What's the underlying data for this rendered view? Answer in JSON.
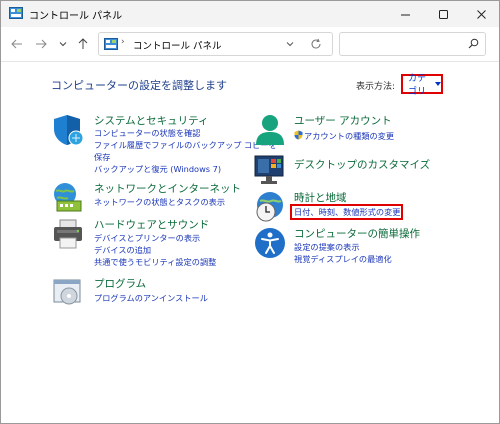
{
  "window": {
    "title": "コントロール パネル"
  },
  "nav": {
    "breadcrumb_separator": "›",
    "address_path": "コントロール パネル",
    "search_placeholder": ""
  },
  "main": {
    "heading": "コンピューターの設定を調整します",
    "view_by_label": "表示方法:",
    "view_by_value": "カテゴリ"
  },
  "categories": [
    {
      "title": "システムとセキュリティ",
      "links": [
        "コンピューターの状態を確認",
        "ファイル履歴でファイルのバックアップ コピーを",
        "保存",
        "バックアップと復元 (Windows 7)"
      ]
    },
    {
      "title": "ネットワークとインターネット",
      "links": [
        "ネットワークの状態とタスクの表示"
      ]
    },
    {
      "title": "ハードウェアとサウンド",
      "links": [
        "デバイスとプリンターの表示",
        "デバイスの追加",
        "共通で使うモビリティ設定の調整"
      ]
    },
    {
      "title": "プログラム",
      "links": [
        "プログラムのアンインストール"
      ]
    },
    {
      "title": "ユーザー アカウント",
      "links": [
        "アカウントの種類の変更"
      ]
    },
    {
      "title": "デスクトップのカスタマイズ",
      "links": []
    },
    {
      "title": "時計と地域",
      "links": [
        "日付、時刻、数値形式の変更"
      ]
    },
    {
      "title": "コンピューターの簡単操作",
      "links": [
        "設定の提案の表示",
        "視覚ディスプレイの最適化"
      ]
    }
  ],
  "colors": {
    "highlight": "#e00000",
    "link": "#1a36b8",
    "category_title": "#0a6a3a",
    "heading": "#1e3f8c"
  }
}
